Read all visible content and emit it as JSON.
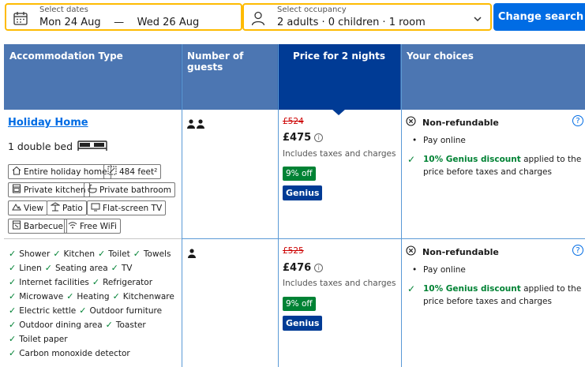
{
  "search": {
    "dates_label": "Select dates",
    "check_in": "Mon 24 Aug",
    "date_separator": "—",
    "check_out": "Wed 26 Aug",
    "occupancy_label": "Select occupancy",
    "occupancy_value": "2 adults · 0 children · 1 room",
    "change_button": "Change search"
  },
  "table": {
    "headers": {
      "type": "Accommodation Type",
      "guests": "Number of guests",
      "price": "Price for 2 nights",
      "choices": "Your choices"
    },
    "room": {
      "name": "Holiday Home",
      "bed": "1 double bed",
      "chips": [
        {
          "icon": "house-icon",
          "label": "Entire holiday home"
        },
        {
          "icon": "size-icon",
          "label": "484 feet²"
        },
        {
          "icon": "kitchen-icon",
          "label": "Private kitchen"
        },
        {
          "icon": "bath-icon",
          "label": "Private bathroom"
        },
        {
          "icon": "mountain-icon",
          "label": "View"
        },
        {
          "icon": "patio-icon",
          "label": "Patio"
        },
        {
          "icon": "tv-icon",
          "label": "Flat-screen TV"
        },
        {
          "icon": "grill-icon",
          "label": "Barbecue"
        },
        {
          "icon": "wifi-icon",
          "label": "Free WiFi"
        }
      ],
      "facilities": [
        "Shower",
        "Kitchen",
        "Toilet",
        "Towels",
        "Linen",
        "Seating area",
        "TV",
        "Internet facilities",
        "Refrigerator",
        "Microwave",
        "Heating",
        "Kitchenware",
        "Electric kettle",
        "Outdoor furniture",
        "Outdoor dining area",
        "Toaster",
        "Toilet paper",
        "Carbon monoxide detector"
      ]
    },
    "options": [
      {
        "guests": 2,
        "old_price": "£524",
        "new_price": "£475",
        "tax_note": "Includes taxes and charges",
        "discount": "9% off",
        "genius": "Genius",
        "refund": "Non-refundable",
        "payment": "Pay online",
        "genius_bold": "10% Genius discount",
        "genius_rest": " applied to the price before taxes and charges"
      },
      {
        "guests": 1,
        "old_price": "£525",
        "new_price": "£476",
        "tax_note": "Includes taxes and charges",
        "discount": "9% off",
        "genius": "Genius",
        "refund": "Non-refundable",
        "payment": "Pay online",
        "genius_bold": "10% Genius discount",
        "genius_rest": " applied to the price before taxes and charges"
      }
    ]
  },
  "colors": {
    "header_bg": "#4c76b2",
    "price_header_bg": "#003b95",
    "accent_blue": "#006ce4",
    "highlight_yellow": "#febb02",
    "discount_green": "#008234",
    "strike_red": "#cc0000"
  }
}
